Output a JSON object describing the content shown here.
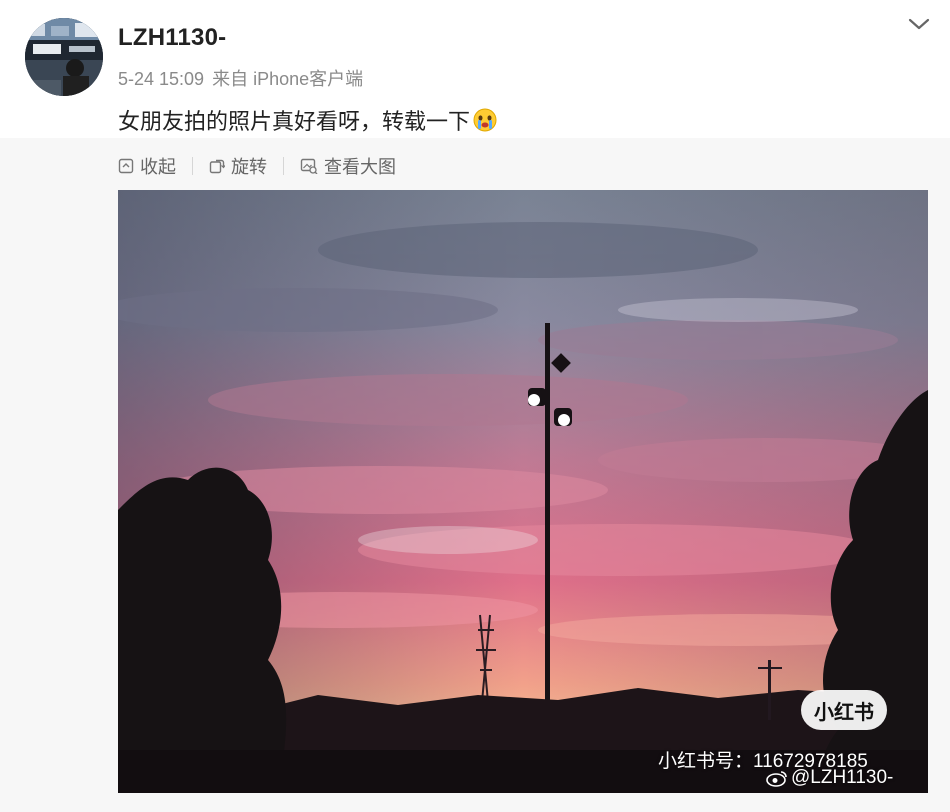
{
  "post": {
    "username": "LZH1130-",
    "date": "5-24 15:09",
    "source": "来自 iPhone客户端",
    "text": "女朋友拍的照片真好看呀，转载一下",
    "emoji_icon": "crying-face-emoji"
  },
  "toolbar": {
    "collapse_label": "收起",
    "rotate_label": "旋转",
    "view_large_label": "查看大图",
    "collapse_icon": "collapse-icon",
    "rotate_icon": "rotate-icon",
    "view_large_icon": "view-large-icon"
  },
  "photo": {
    "description_icon": "sunset-photo",
    "badge": "小红书",
    "xhs_id": "小红书号：11672978185",
    "weibo_watermark": "@LZH1130-"
  },
  "colors": {
    "username": "#222222",
    "meta": "#8a8a8a",
    "toolbar_text": "#666666",
    "media_bg": "#f7f7f7"
  }
}
